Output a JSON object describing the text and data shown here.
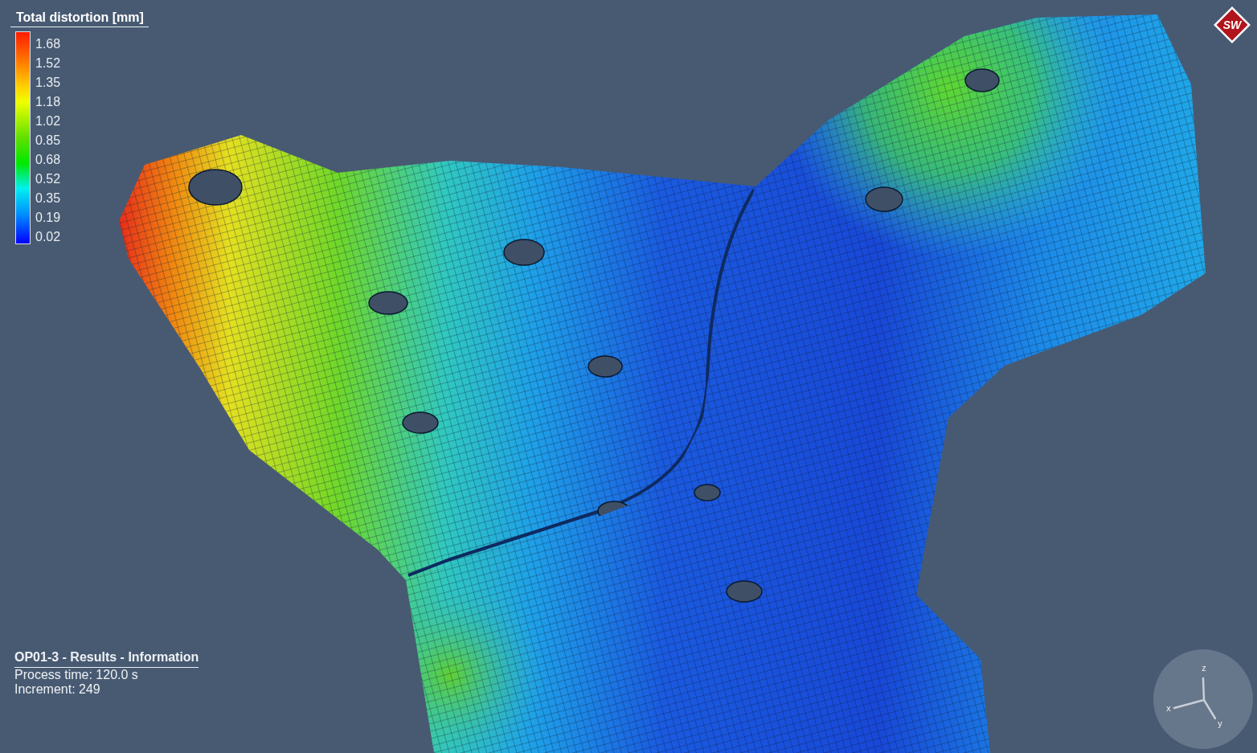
{
  "legend": {
    "title": "Total distortion [mm]",
    "values": [
      "1.68",
      "1.52",
      "1.35",
      "1.18",
      "1.02",
      "0.85",
      "0.68",
      "0.52",
      "0.35",
      "0.19",
      "0.02"
    ]
  },
  "info": {
    "title": "OP01-3 - Results - Information",
    "lines": [
      "Process time: 120.0 s",
      "Increment: 249"
    ]
  },
  "logo": {
    "text": "SW"
  },
  "axes": {
    "x": "x",
    "y": "y",
    "z": "z"
  }
}
